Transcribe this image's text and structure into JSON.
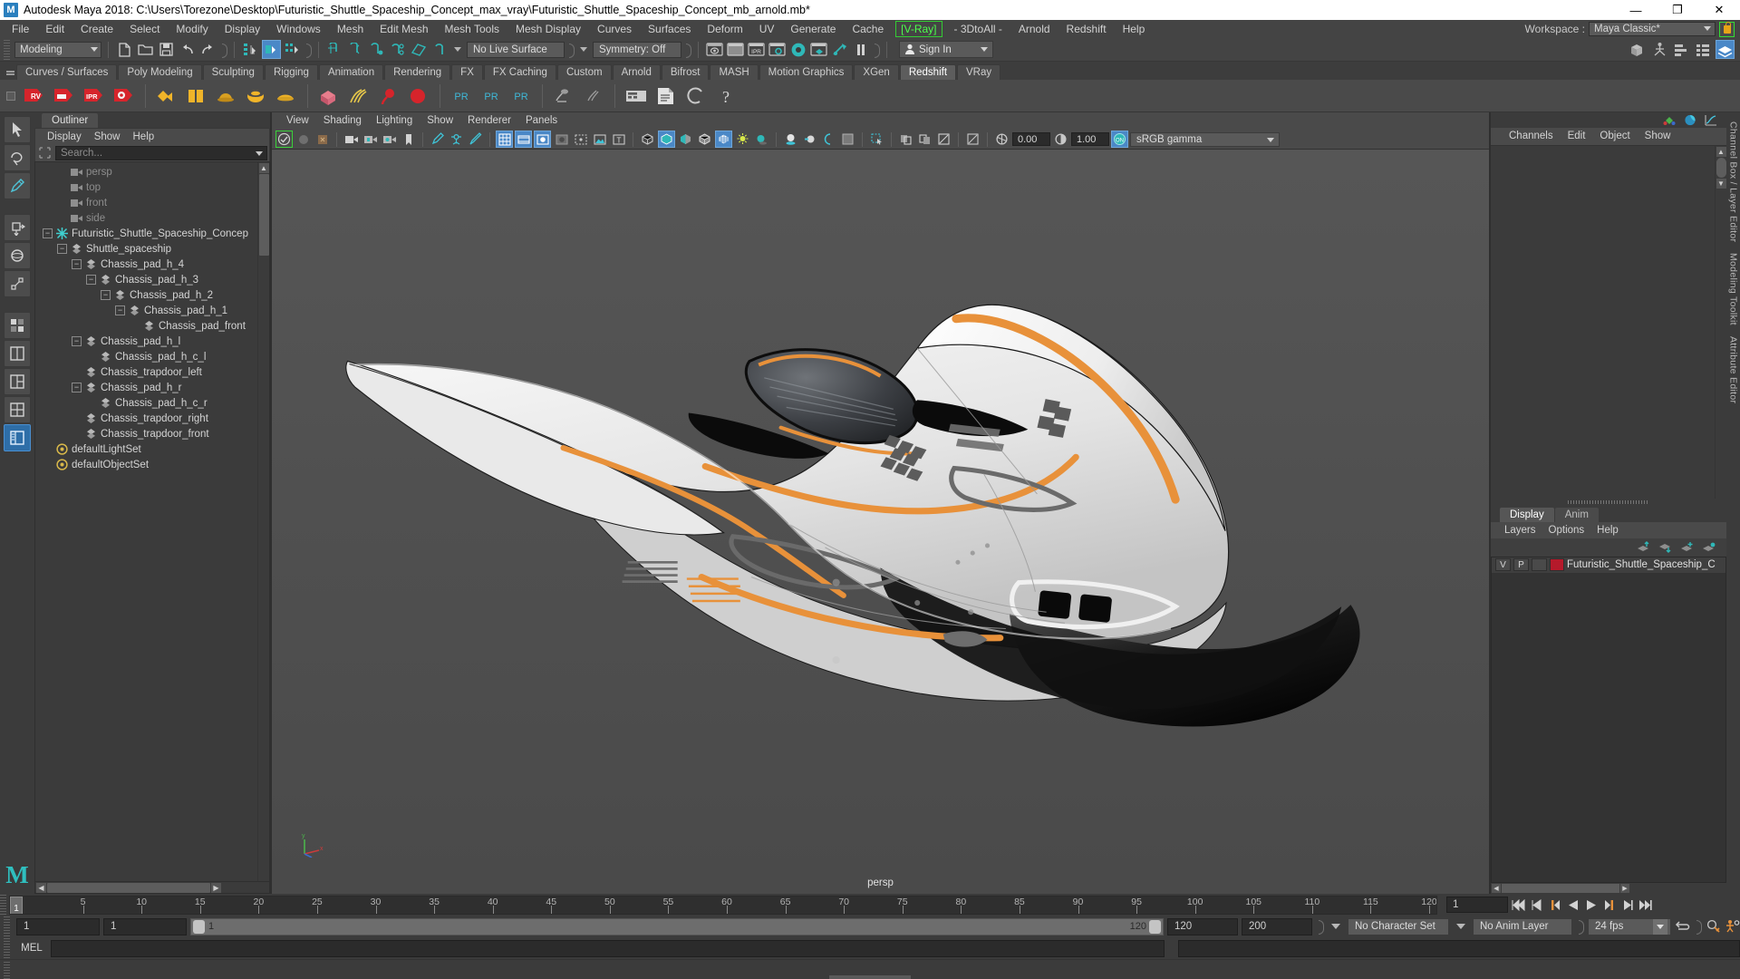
{
  "titlebar": {
    "app_title": "Autodesk Maya 2018: C:\\Users\\Torezone\\Desktop\\Futuristic_Shuttle_Spaceship_Concept_max_vray\\Futuristic_Shuttle_Spaceship_Concept_mb_arnold.mb*",
    "logo_text": "M",
    "minimize": "—",
    "maximize": "❐",
    "close": "✕"
  },
  "menubar": {
    "items": [
      {
        "label": "File"
      },
      {
        "label": "Edit"
      },
      {
        "label": "Create"
      },
      {
        "label": "Select"
      },
      {
        "label": "Modify"
      },
      {
        "label": "Display"
      },
      {
        "label": "Windows"
      },
      {
        "label": "Mesh"
      },
      {
        "label": "Edit Mesh"
      },
      {
        "label": "Mesh Tools"
      },
      {
        "label": "Mesh Display"
      },
      {
        "label": "Curves"
      },
      {
        "label": "Surfaces"
      },
      {
        "label": "Deform"
      },
      {
        "label": "UV"
      },
      {
        "label": "Generate"
      },
      {
        "label": "Cache"
      },
      {
        "label": "[V-Ray]",
        "highlight": true
      },
      {
        "label": "- 3DtoAll -"
      },
      {
        "label": "Arnold"
      },
      {
        "label": "Redshift"
      },
      {
        "label": "Help"
      }
    ],
    "workspace_label": "Workspace :",
    "workspace_value": "Maya Classic*",
    "lock_icon": "lock-icon"
  },
  "statusbar": {
    "mode_value": "Modeling",
    "live_surface": "No Live Surface",
    "symmetry": "Symmetry: Off",
    "signin": "Sign In",
    "render_icons": [
      "render-view-icon",
      "render-region-icon",
      "ipr-icon",
      "render-settings-icon",
      "arnold-render-icon",
      "arnold-ipr-icon",
      "arnold-flush-icon",
      "pause-icon"
    ]
  },
  "shelf": {
    "tabs": [
      {
        "label": "Curves / Surfaces"
      },
      {
        "label": "Poly Modeling"
      },
      {
        "label": "Sculpting"
      },
      {
        "label": "Rigging"
      },
      {
        "label": "Animation"
      },
      {
        "label": "Rendering"
      },
      {
        "label": "FX"
      },
      {
        "label": "FX Caching"
      },
      {
        "label": "Custom"
      },
      {
        "label": "Arnold"
      },
      {
        "label": "Bifrost"
      },
      {
        "label": "MASH"
      },
      {
        "label": "Motion Graphics"
      },
      {
        "label": "XGen"
      },
      {
        "label": "Redshift",
        "active": true
      },
      {
        "label": "VRay"
      }
    ],
    "button_labels": [
      "RV",
      "",
      "IPR",
      "",
      "PR",
      "PR",
      "PR"
    ]
  },
  "toolbox": {
    "items": [
      {
        "name": "select-tool",
        "active": false
      },
      {
        "name": "lasso-select-tool",
        "active": false
      },
      {
        "name": "paint-select-tool",
        "active": false
      },
      {
        "name": "move-tool",
        "active": false
      },
      {
        "name": "rotate-tool",
        "active": false
      },
      {
        "name": "scale-tool",
        "active": false
      },
      {
        "name": "last-tool",
        "active": false
      },
      {
        "name": "layout-single-icon",
        "active": false
      },
      {
        "name": "layout-two-panes-icon",
        "active": false
      },
      {
        "name": "layout-four-panes-icon",
        "active": false
      },
      {
        "name": "layout-persp-outliner-icon",
        "active": true
      }
    ],
    "logo": "M"
  },
  "outliner": {
    "tab": "Outliner",
    "menus": [
      "Display",
      "Show",
      "Help"
    ],
    "search_placeholder": "Search...",
    "filter_icon": "filter-icon",
    "tree": [
      {
        "label": "persp",
        "depth": 1,
        "icon": "camera-icon",
        "dim": true,
        "expander": "none"
      },
      {
        "label": "top",
        "depth": 1,
        "icon": "camera-icon",
        "dim": true,
        "expander": "none"
      },
      {
        "label": "front",
        "depth": 1,
        "icon": "camera-icon",
        "dim": true,
        "expander": "none"
      },
      {
        "label": "side",
        "depth": 1,
        "icon": "camera-icon",
        "dim": true,
        "expander": "none"
      },
      {
        "label": "Futuristic_Shuttle_Spaceship_Concep",
        "depth": 0,
        "icon": "group-icon",
        "dim": false,
        "expander": "minus"
      },
      {
        "label": "Shuttle_spaceship",
        "depth": 1,
        "icon": "mesh-icon",
        "dim": false,
        "expander": "minus"
      },
      {
        "label": "Chassis_pad_h_4",
        "depth": 2,
        "icon": "mesh-icon",
        "dim": false,
        "expander": "minus"
      },
      {
        "label": "Chassis_pad_h_3",
        "depth": 3,
        "icon": "mesh-icon",
        "dim": false,
        "expander": "minus"
      },
      {
        "label": "Chassis_pad_h_2",
        "depth": 4,
        "icon": "mesh-icon",
        "dim": false,
        "expander": "minus"
      },
      {
        "label": "Chassis_pad_h_1",
        "depth": 5,
        "icon": "mesh-icon",
        "dim": false,
        "expander": "minus"
      },
      {
        "label": "Chassis_pad_front",
        "depth": 6,
        "icon": "mesh-icon",
        "dim": false,
        "expander": "none"
      },
      {
        "label": "Chassis_pad_h_l",
        "depth": 2,
        "icon": "mesh-icon",
        "dim": false,
        "expander": "minus"
      },
      {
        "label": "Chassis_pad_h_c_l",
        "depth": 3,
        "icon": "mesh-icon",
        "dim": false,
        "expander": "none"
      },
      {
        "label": "Chassis_trapdoor_left",
        "depth": 2,
        "icon": "mesh-icon",
        "dim": false,
        "expander": "none"
      },
      {
        "label": "Chassis_pad_h_r",
        "depth": 2,
        "icon": "mesh-icon",
        "dim": false,
        "expander": "minus"
      },
      {
        "label": "Chassis_pad_h_c_r",
        "depth": 3,
        "icon": "mesh-icon",
        "dim": false,
        "expander": "none"
      },
      {
        "label": "Chassis_trapdoor_right",
        "depth": 2,
        "icon": "mesh-icon",
        "dim": false,
        "expander": "none"
      },
      {
        "label": "Chassis_trapdoor_front",
        "depth": 2,
        "icon": "mesh-icon",
        "dim": false,
        "expander": "none"
      },
      {
        "label": "defaultLightSet",
        "depth": 0,
        "icon": "set-icon",
        "dim": false,
        "expander": "none"
      },
      {
        "label": "defaultObjectSet",
        "depth": 0,
        "icon": "set-icon",
        "dim": false,
        "expander": "none"
      }
    ]
  },
  "viewport": {
    "menus": [
      "View",
      "Shading",
      "Lighting",
      "Show",
      "Renderer",
      "Panels"
    ],
    "exposure_value": "0.00",
    "gamma_value": "1.00",
    "color_space": "sRGB gamma",
    "camera_label": "persp",
    "gate_toggle": "on"
  },
  "channelbox": {
    "menus": [
      "Channels",
      "Edit",
      "Object",
      "Show"
    ],
    "header_icons": [
      "channel-box-icon",
      "attribute-editor-icon",
      "graph-editor-icon"
    ]
  },
  "layers": {
    "tabs": [
      {
        "label": "Display",
        "active": true
      },
      {
        "label": "Anim",
        "active": false
      }
    ],
    "menus": [
      "Layers",
      "Options",
      "Help"
    ],
    "toolbar_icons": [
      "move-layer-up-icon",
      "move-layer-down-icon",
      "new-layer-from-selected-icon",
      "new-layer-icon"
    ],
    "rows": [
      {
        "v": "V",
        "p": "P",
        "blank": "",
        "color": "#b51a2b",
        "name": "Futuristic_Shuttle_Spaceship_C"
      }
    ]
  },
  "sidetabs": {
    "right": [
      "Channel Box / Layer Editor",
      "Modeling Toolkit",
      "Attribute Editor"
    ]
  },
  "timeline": {
    "current_frame": "1",
    "ticks": [
      5,
      10,
      15,
      20,
      25,
      30,
      35,
      40,
      45,
      50,
      55,
      60,
      65,
      70,
      75,
      80,
      85,
      90,
      95,
      100,
      105,
      110,
      115,
      120
    ],
    "frame_field": "1",
    "playback_icons": [
      "go-to-start-icon",
      "step-back-keyframe-icon",
      "step-back-frame-icon",
      "play-backwards-icon",
      "play-forwards-icon",
      "step-forward-frame-icon",
      "step-forward-keyframe-icon",
      "go-to-end-icon"
    ]
  },
  "rangeslider": {
    "start_field": "1",
    "anim_start_field": "1",
    "range_left_label": "1",
    "range_right_label": "120",
    "anim_end_field": "120",
    "end_field": "200",
    "character_set": "No Character Set",
    "anim_layer": "No Anim Layer",
    "fps": "24 fps",
    "icons": [
      "loop-icon",
      "auto-key-icon",
      "animation-preferences-icon"
    ]
  },
  "commandline": {
    "language": "MEL",
    "input_value": "",
    "output_value": ""
  },
  "colors": {
    "accent_blue": "#4a88c7",
    "teal": "#2fb8b8",
    "vray_green": "#4cff4c",
    "layer_red": "#b51a2b",
    "orange": "#e8913a"
  }
}
